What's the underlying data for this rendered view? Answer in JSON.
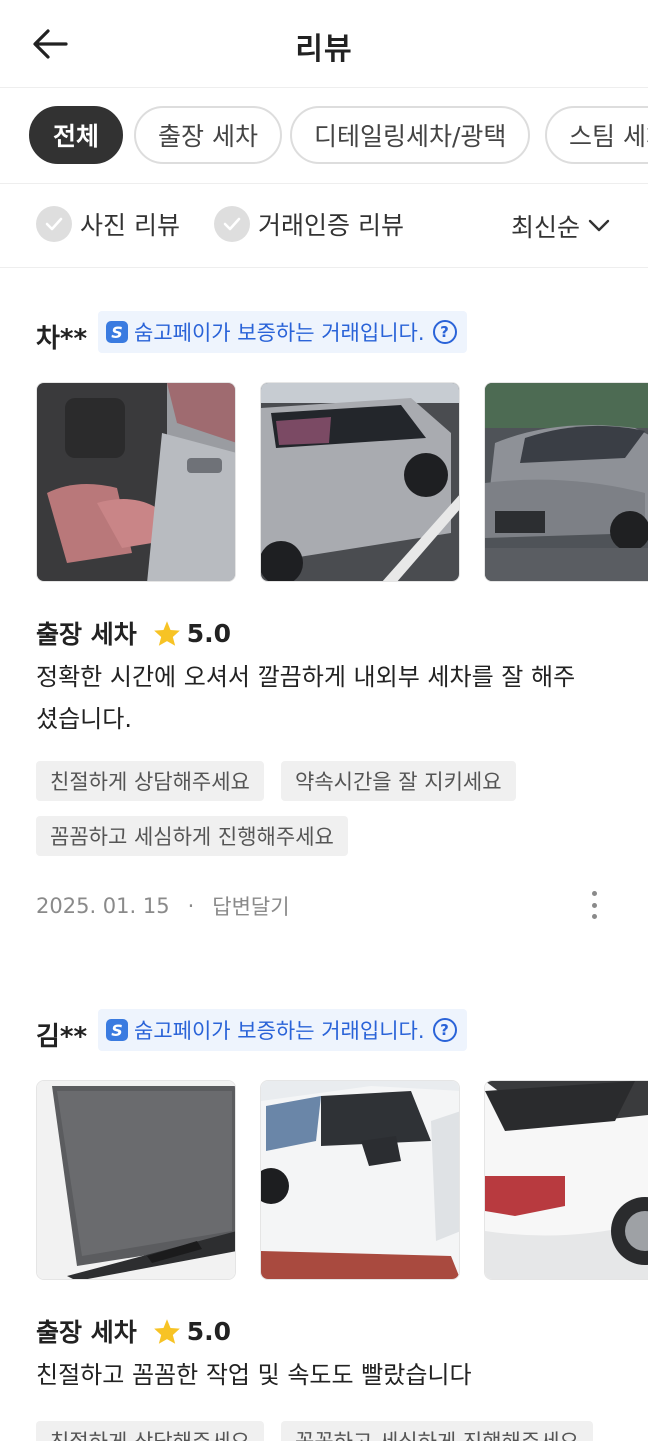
{
  "header": {
    "title": "리뷰",
    "back_icon": "arrow-left-icon"
  },
  "chips": [
    {
      "label": "전체",
      "active": true
    },
    {
      "label": "출장 세차",
      "active": false
    },
    {
      "label": "디테일링세차/광택",
      "active": false
    },
    {
      "label": "스팀 세차",
      "active": false
    }
  ],
  "filters": {
    "photo_review": "사진 리뷰",
    "verified_review": "거래인증 리뷰",
    "sort_label": "최신순",
    "check_icon": "check-icon",
    "sort_icon": "chevron-down-icon"
  },
  "badge_text": "숨고페이가 보증하는 거래입니다.",
  "badge_logo": "S",
  "badge_help": "?",
  "reviews": [
    {
      "reviewer": "차**",
      "service": "출장 세차",
      "rating": "5.0",
      "text": "정확한 시간에 오셔서 깔끔하게 내외부 세차를 잘 해주셨습니다.",
      "tags": [
        "친절하게 상담해주세요",
        "약속시간을 잘 지키세요",
        "꼼꼼하고 세심하게 진행해주세요"
      ],
      "date": "2025. 01. 15",
      "reply": "답변달기"
    },
    {
      "reviewer": "김**",
      "service": "출장 세차",
      "rating": "5.0",
      "text": "친절하고 꼼꼼한 작업 및 속도도 빨랐습니다",
      "tags": [
        "친절하게 상담해주세요",
        "꼼꼼하고 세심하게 진행해주세요"
      ]
    }
  ],
  "meta_separator": "·",
  "colors": {
    "accent": "#2a63d8",
    "star": "#f7c325",
    "chip_active": "#323232"
  }
}
